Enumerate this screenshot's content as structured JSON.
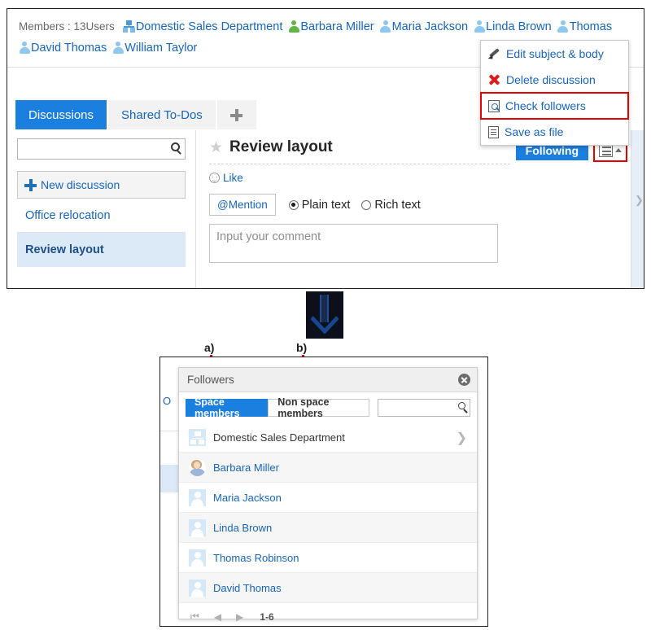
{
  "members_bar": {
    "label": "Members : 13Users",
    "entries": [
      {
        "name": "Domestic Sales Department",
        "icon": "org-icon",
        "status": "org"
      },
      {
        "name": "Barbara Miller",
        "icon": "person-icon",
        "status": "green"
      },
      {
        "name": "Maria Jackson",
        "icon": "person-icon",
        "status": "blue"
      },
      {
        "name": "Linda Brown",
        "icon": "person-icon",
        "status": "blue"
      },
      {
        "name": "Thomas",
        "icon": "person-icon",
        "status": "blue"
      },
      {
        "name": "David Thomas",
        "icon": "person-icon",
        "status": "blue"
      },
      {
        "name": "William Taylor",
        "icon": "person-icon",
        "status": "blue"
      }
    ]
  },
  "tabs": [
    {
      "label": "Discussions",
      "state": "active"
    },
    {
      "label": "Shared To-Dos",
      "state": "inactive"
    },
    {
      "label": "",
      "state": "add"
    }
  ],
  "sidebar": {
    "search_placeholder": "",
    "search_value": "",
    "new_discussion_label": "New discussion",
    "items": [
      {
        "label": "Office relocation",
        "selected": false
      },
      {
        "label": "Review layout",
        "selected": true
      }
    ]
  },
  "discussion": {
    "title": "Review layout",
    "like_label": "Like",
    "mention_label": "@Mention",
    "format_options": [
      {
        "label": "Plain text",
        "selected": true
      },
      {
        "label": "Rich text",
        "selected": false
      }
    ],
    "comment_placeholder": "Input your comment",
    "following_label": "Following"
  },
  "dropdown_menu": {
    "items": [
      {
        "label": "Edit subject & body",
        "icon": "pencil-icon",
        "highlighted": false
      },
      {
        "label": "Delete discussion",
        "icon": "delete-x-icon",
        "highlighted": false
      },
      {
        "label": "Check followers",
        "icon": "inspect-icon",
        "highlighted": true
      },
      {
        "label": "Save as file",
        "icon": "document-icon",
        "highlighted": false
      }
    ]
  },
  "callouts": [
    {
      "label": "a)"
    },
    {
      "label": "b)"
    }
  ],
  "followers_dialog": {
    "title": "Followers",
    "segments": [
      {
        "label": "Space members",
        "selected": true
      },
      {
        "label": "Non space members",
        "selected": false
      }
    ],
    "search_value": "",
    "search_placeholder": "",
    "rows": [
      {
        "name": "Domestic Sales Department",
        "avatar": "org-avatar",
        "type": "org",
        "has_chevron": true
      },
      {
        "name": "Barbara Miller",
        "avatar": "photo-avatar",
        "type": "user",
        "has_chevron": false
      },
      {
        "name": "Maria Jackson",
        "avatar": "user-avatar",
        "type": "user",
        "has_chevron": false
      },
      {
        "name": "Linda Brown",
        "avatar": "user-avatar",
        "type": "user",
        "has_chevron": false
      },
      {
        "name": "Thomas Robinson",
        "avatar": "user-avatar",
        "type": "user",
        "has_chevron": false
      },
      {
        "name": "David Thomas",
        "avatar": "user-avatar",
        "type": "user",
        "has_chevron": false
      }
    ],
    "pager": {
      "first_icon": "first-page-icon",
      "prev_icon": "prev-page-icon",
      "next_icon": "next-page-icon",
      "range": "1-6"
    }
  },
  "background_peek": {
    "text": "O"
  },
  "colors": {
    "accent_blue": "#1b7fe0",
    "link_blue": "#1565c0",
    "highlight_red": "#e60000",
    "selected_row": "#dce9f7",
    "status_green": "#62b544"
  }
}
